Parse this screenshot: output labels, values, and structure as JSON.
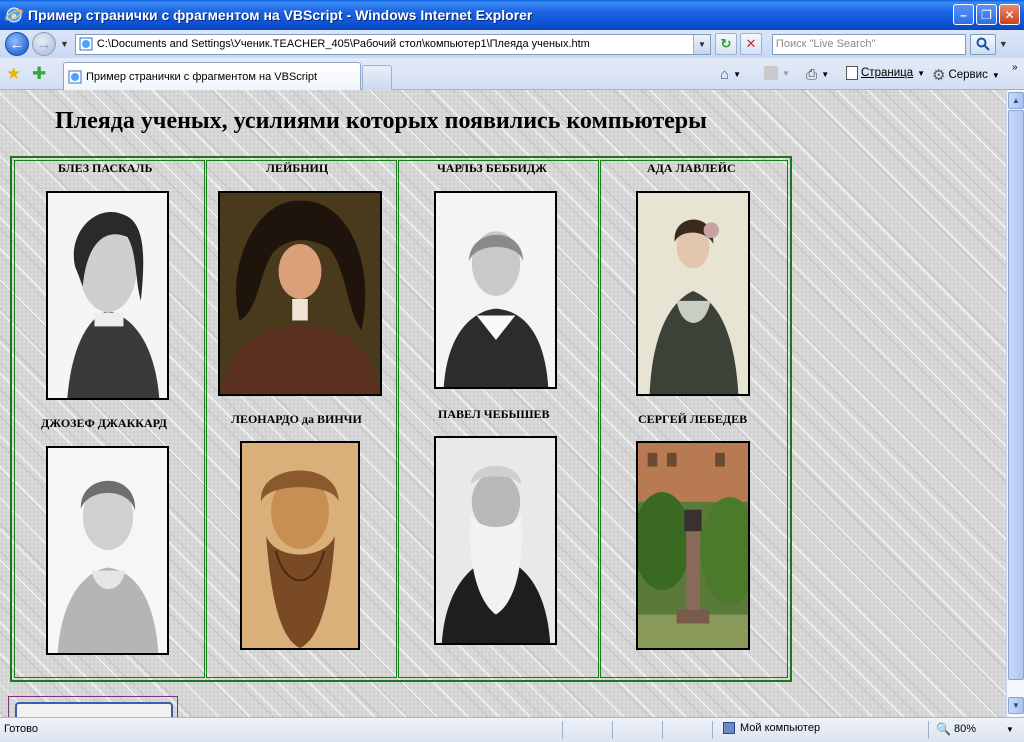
{
  "window": {
    "title": "Пример странички с фрагментом на VBScript - Windows Internet Explorer"
  },
  "toolbar": {
    "address_url": "C:\\Documents and Settings\\Ученик.TEACHER_405\\Рабочий стол\\компьютер1\\Плеяда ученых.htm",
    "search_placeholder": "Поиск \"Live Search\""
  },
  "tabs": [
    {
      "label": "Пример странички с фрагментом на VBScript",
      "active": true
    }
  ],
  "commands": {
    "page_label": "Страница",
    "tools_label": "Сервис"
  },
  "page": {
    "heading": "Плеяда ученых, усилиями которых появились компьютеры",
    "scientists": [
      {
        "name": "БЛЕЗ ПАСКАЛЬ",
        "portrait_icon": "portrait-bw"
      },
      {
        "name": "ЛЕЙБНИЦ",
        "portrait_icon": "portrait-color"
      },
      {
        "name": "ЧАРЛЬЗ БЕББИДЖ",
        "portrait_icon": "portrait-bw"
      },
      {
        "name": "АДА ЛАВЛЕЙС",
        "portrait_icon": "portrait-color"
      },
      {
        "name": "ДЖОЗЕФ ДЖАККАРД",
        "portrait_icon": "portrait-bw"
      },
      {
        "name": "ЛЕОНАРДО да ВИНЧИ",
        "portrait_icon": "portrait-sepia"
      },
      {
        "name": "ПАВЕЛ ЧЕБЫШЕВ",
        "portrait_icon": "portrait-bw"
      },
      {
        "name": "СЕРГЕЙ ЛЕБЕДЕВ",
        "portrait_icon": "monument-photo"
      }
    ]
  },
  "status": {
    "text": "Готово",
    "zone": "Мой компьютер",
    "zoom": "80%"
  },
  "colors": {
    "table_border": "#1a7a1a",
    "titlebar": "#0b4fd0"
  }
}
